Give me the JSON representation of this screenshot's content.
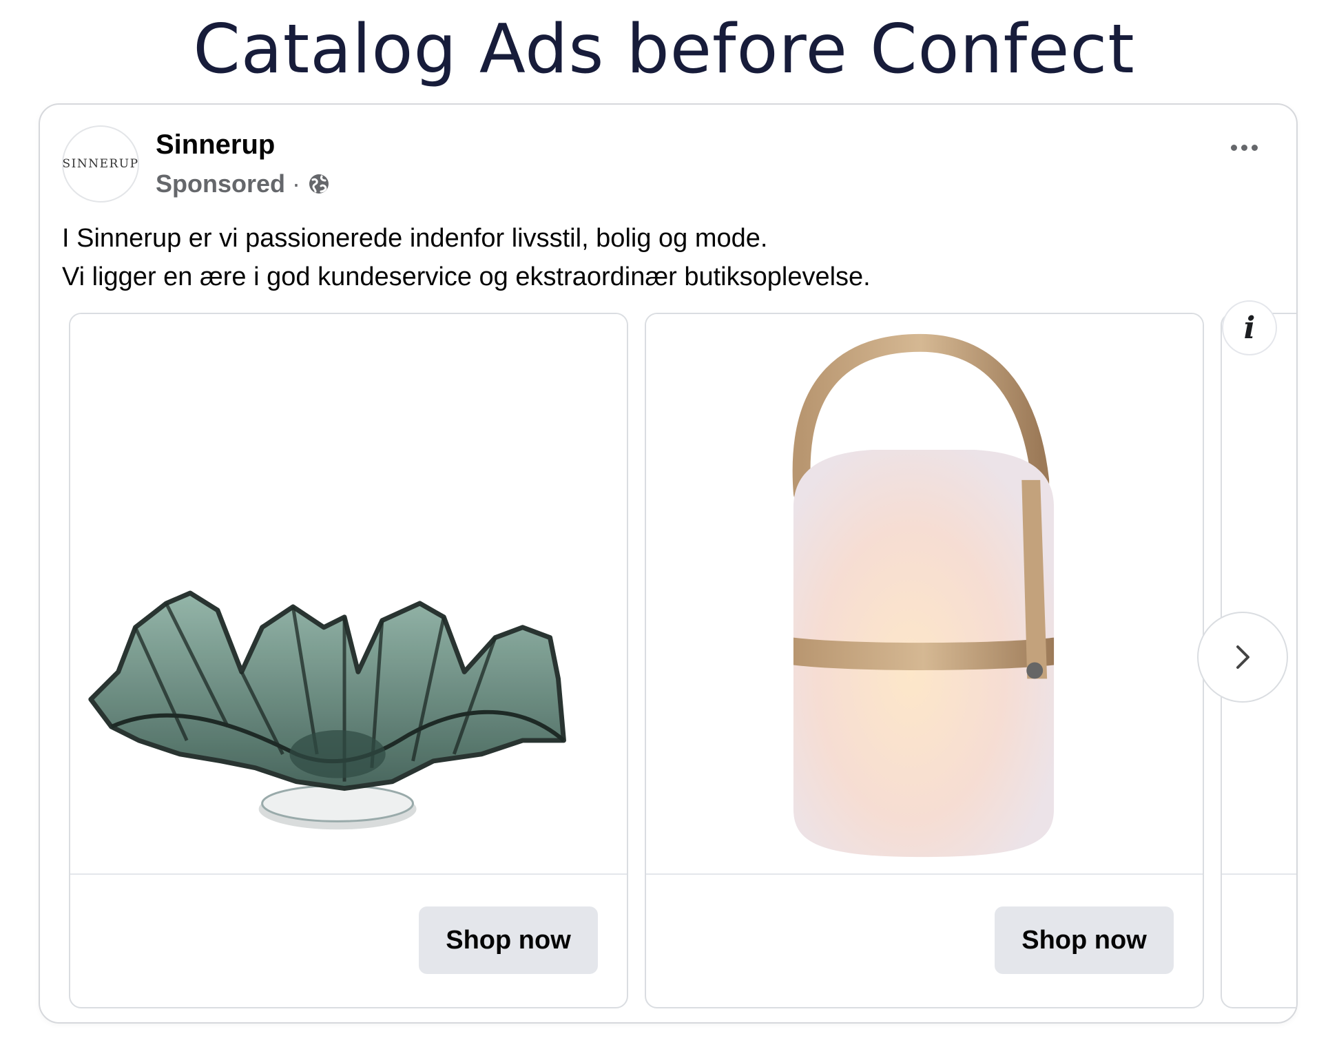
{
  "headline": "Catalog Ads before Confect",
  "post": {
    "avatar_text": "SINNERUP",
    "page_name": "Sinnerup",
    "sponsored_label": "Sponsored",
    "separator": "·",
    "body_lines": [
      "I Sinnerup er vi passionerede indenfor livsstil, bolig og mode.",
      "Vi ligger en ære i god kundeservice og ekstraordinær butiksoplevelse."
    ]
  },
  "carousel": {
    "cards": [
      {
        "product_icon": "glass-bowl",
        "button_label": "Shop now"
      },
      {
        "product_icon": "lantern-lamp",
        "button_label": "Shop now"
      }
    ],
    "info_label": "i"
  },
  "colors": {
    "headline": "#171c3a",
    "button_bg": "#e4e6eb",
    "muted_text": "#65676b"
  }
}
